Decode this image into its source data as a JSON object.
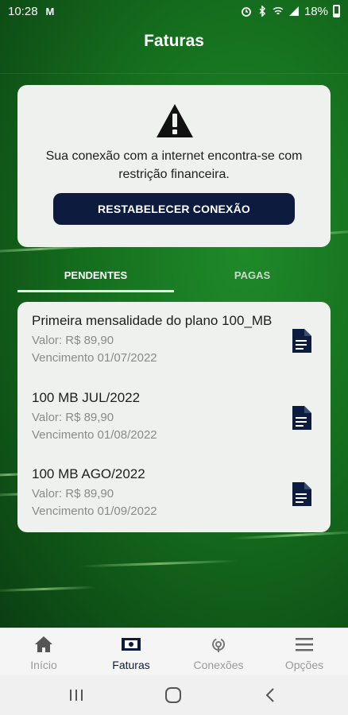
{
  "status_bar": {
    "time": "10:28",
    "left_icon": "M",
    "battery": "18%",
    "icons": [
      "alarm-icon",
      "bluetooth-icon",
      "wifi-icon",
      "signal-icon",
      "battery-icon"
    ]
  },
  "header": {
    "title": "Faturas"
  },
  "alert": {
    "icon": "warning-icon",
    "message": "Sua conexão com a internet encontra-se com restrição financeira.",
    "button_label": "RESTABELECER CONEXÃO"
  },
  "tabs": [
    {
      "label": "PENDENTES",
      "active": true
    },
    {
      "label": "PAGAS",
      "active": false
    }
  ],
  "invoices": [
    {
      "title": "Primeira mensalidade do plano 100_MB",
      "value": "Valor: R$ 89,90",
      "due": "Vencimento 01/07/2022"
    },
    {
      "title": "100 MB JUL/2022",
      "value": "Valor: R$ 89,90",
      "due": "Vencimento 01/08/2022"
    },
    {
      "title": "100 MB AGO/2022",
      "value": "Valor: R$ 89,90",
      "due": "Vencimento 01/09/2022"
    }
  ],
  "bottom_nav": [
    {
      "label": "Início",
      "icon": "home-icon",
      "active": false
    },
    {
      "label": "Faturas",
      "icon": "invoice-icon",
      "active": true
    },
    {
      "label": "Conexões",
      "icon": "connection-icon",
      "active": false
    },
    {
      "label": "Opções",
      "icon": "menu-icon",
      "active": false
    }
  ],
  "colors": {
    "primary_green": "#156f1e",
    "button_navy": "#0d1b3f",
    "card_bg": "#eef1ee"
  }
}
